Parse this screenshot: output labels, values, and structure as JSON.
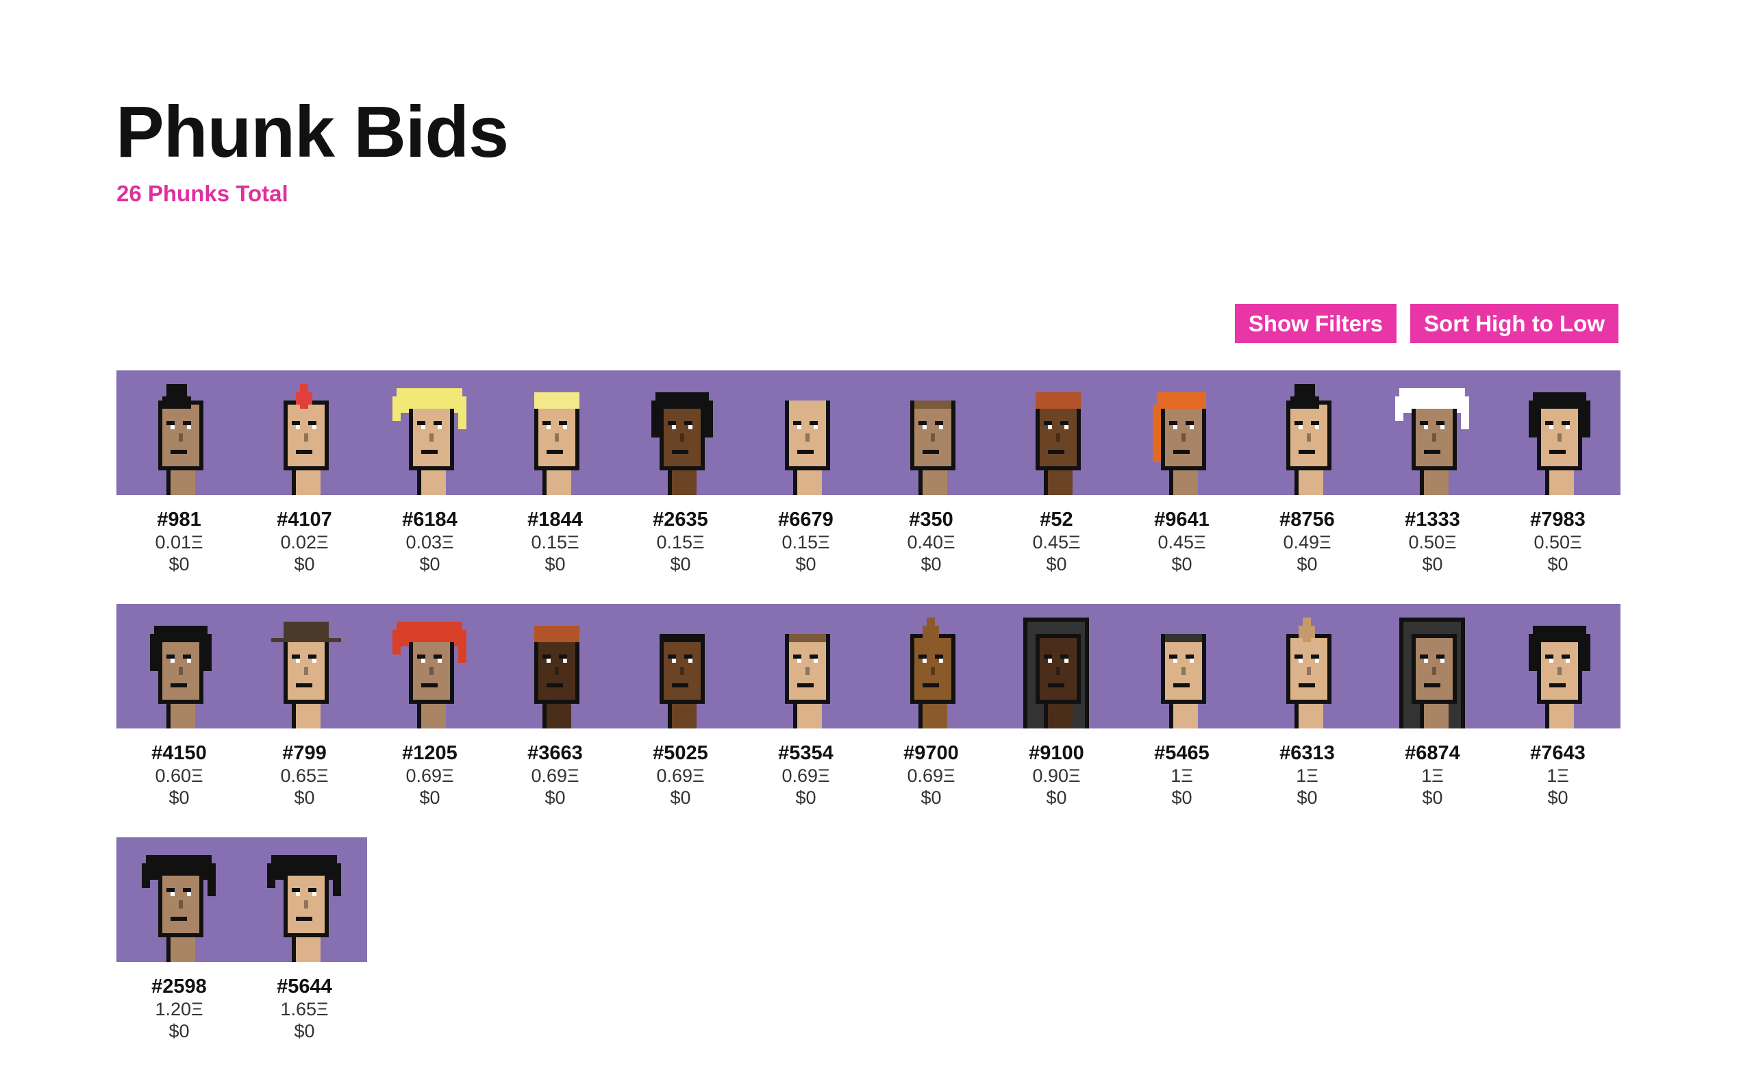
{
  "header": {
    "title": "Phunk Bids",
    "subtitle": "26 Phunks Total"
  },
  "toolbar": {
    "filters_label": "Show Filters",
    "sort_label": "Sort High to Low"
  },
  "colors": {
    "accent": "#e936a7",
    "tile_background": "#8670b2"
  },
  "phunks": [
    {
      "id": "#981",
      "eth": "0.01Ξ",
      "usd": "$0",
      "skin": "#a98566",
      "hair": "#111111",
      "style": "mohawk"
    },
    {
      "id": "#4107",
      "eth": "0.02Ξ",
      "usd": "$0",
      "skin": "#dbb28a",
      "hair": "#e0403a",
      "style": "mohawk-thin"
    },
    {
      "id": "#6184",
      "eth": "0.03Ξ",
      "usd": "$0",
      "skin": "#dbb28a",
      "hair": "#f1e878",
      "style": "wild"
    },
    {
      "id": "#1844",
      "eth": "0.15Ξ",
      "usd": "$0",
      "skin": "#dbb28a",
      "hair": "#f3e88a",
      "style": "cap"
    },
    {
      "id": "#2635",
      "eth": "0.15Ξ",
      "usd": "$0",
      "skin": "#6b4426",
      "hair": "#111111",
      "style": "bob"
    },
    {
      "id": "#6679",
      "eth": "0.15Ξ",
      "usd": "$0",
      "skin": "#dbb28a",
      "hair": "#dbb28a",
      "style": "short"
    },
    {
      "id": "#350",
      "eth": "0.40Ξ",
      "usd": "$0",
      "skin": "#a98566",
      "hair": "#7a5a3a",
      "style": "short"
    },
    {
      "id": "#52",
      "eth": "0.45Ξ",
      "usd": "$0",
      "skin": "#6b4426",
      "hair": "#b3532a",
      "style": "cap"
    },
    {
      "id": "#9641",
      "eth": "0.45Ξ",
      "usd": "$0",
      "skin": "#a98566",
      "hair": "#e26a22",
      "style": "long"
    },
    {
      "id": "#8756",
      "eth": "0.49Ξ",
      "usd": "$0",
      "skin": "#dbb28a",
      "hair": "#111111",
      "style": "mohawk"
    },
    {
      "id": "#1333",
      "eth": "0.50Ξ",
      "usd": "$0",
      "skin": "#a98566",
      "hair": "#ffffff",
      "style": "wild"
    },
    {
      "id": "#7983",
      "eth": "0.50Ξ",
      "usd": "$0",
      "skin": "#dbb28a",
      "hair": "#111111",
      "style": "bob"
    },
    {
      "id": "#4150",
      "eth": "0.60Ξ",
      "usd": "$0",
      "skin": "#a98566",
      "hair": "#111111",
      "style": "bob"
    },
    {
      "id": "#799",
      "eth": "0.65Ξ",
      "usd": "$0",
      "skin": "#dbb28a",
      "hair": "#4a3a2a",
      "style": "hat"
    },
    {
      "id": "#1205",
      "eth": "0.69Ξ",
      "usd": "$0",
      "skin": "#a98566",
      "hair": "#d8402a",
      "style": "wild"
    },
    {
      "id": "#3663",
      "eth": "0.69Ξ",
      "usd": "$0",
      "skin": "#4a2e1a",
      "hair": "#b3532a",
      "style": "cap"
    },
    {
      "id": "#5025",
      "eth": "0.69Ξ",
      "usd": "$0",
      "skin": "#6b4426",
      "hair": "#111111",
      "style": "short"
    },
    {
      "id": "#5354",
      "eth": "0.69Ξ",
      "usd": "$0",
      "skin": "#dbb28a",
      "hair": "#7a5a3a",
      "style": "short"
    },
    {
      "id": "#9700",
      "eth": "0.69Ξ",
      "usd": "$0",
      "skin": "#8a5a2a",
      "hair": "#8a5a2a",
      "style": "mohawk-thin"
    },
    {
      "id": "#9100",
      "eth": "0.90Ξ",
      "usd": "$0",
      "skin": "#4a2e1a",
      "hair": "#333333",
      "style": "hood"
    },
    {
      "id": "#5465",
      "eth": "1Ξ",
      "usd": "$0",
      "skin": "#dbb28a",
      "hair": "#333333",
      "style": "short"
    },
    {
      "id": "#6313",
      "eth": "1Ξ",
      "usd": "$0",
      "skin": "#dbb28a",
      "hair": "#c49a6a",
      "style": "mohawk-thin"
    },
    {
      "id": "#6874",
      "eth": "1Ξ",
      "usd": "$0",
      "skin": "#a98566",
      "hair": "#333333",
      "style": "hood"
    },
    {
      "id": "#7643",
      "eth": "1Ξ",
      "usd": "$0",
      "skin": "#dbb28a",
      "hair": "#111111",
      "style": "bob"
    },
    {
      "id": "#2598",
      "eth": "1.20Ξ",
      "usd": "$0",
      "skin": "#a98566",
      "hair": "#111111",
      "style": "wild"
    },
    {
      "id": "#5644",
      "eth": "1.65Ξ",
      "usd": "$0",
      "skin": "#dbb28a",
      "hair": "#111111",
      "style": "wild"
    }
  ]
}
